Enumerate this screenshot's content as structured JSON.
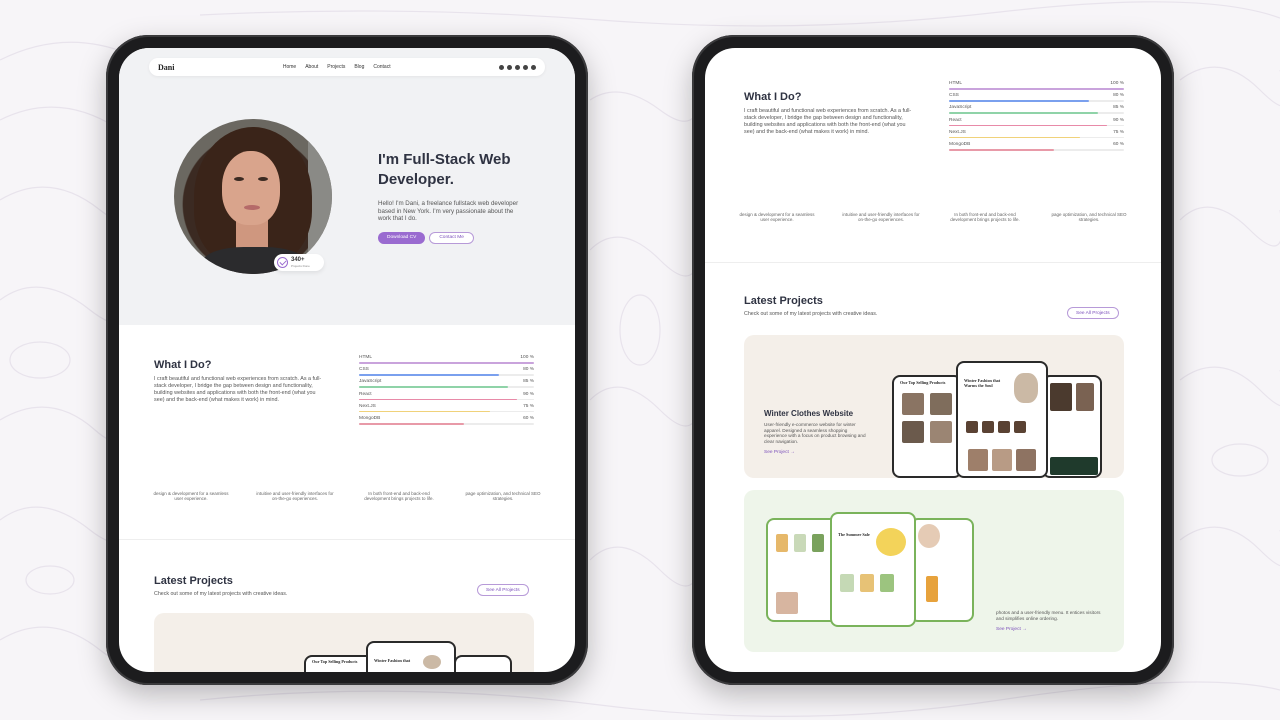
{
  "site": {
    "logo": "Dani",
    "nav": [
      "Home",
      "About",
      "Projects",
      "Blog",
      "Contact"
    ],
    "social_icons": [
      "facebook-icon",
      "instagram-icon",
      "twitter-icon",
      "youtube-icon",
      "dribbble-icon"
    ]
  },
  "hero": {
    "title": "I'm Full-Stack Web Developer.",
    "intro": "Hello! I'm Dani, a freelance fullstack web developer based in New York. I'm very passionate about the work that I do.",
    "download_cv": "Download CV",
    "contact_me": "Contact Me",
    "badge_count": "340+",
    "badge_label": "Projects Done"
  },
  "what_i_do": {
    "title": "What I Do?",
    "description": "I craft beautiful and functional web experiences from scratch. As a full-stack developer, I bridge the gap between design and functionality, building websites and applications with both the front-end (what you see) and the back-end (what makes it work) in mind.",
    "skills": [
      {
        "name": "HTML",
        "percent": "100 %",
        "value": 1.0,
        "color": "#c9a3dc"
      },
      {
        "name": "CSS",
        "percent": "80 %",
        "value": 0.8,
        "color": "#7aa0ee"
      },
      {
        "name": "JavaScript",
        "percent": "85 %",
        "value": 0.85,
        "color": "#8fd3a8"
      },
      {
        "name": "React",
        "percent": "90 %",
        "value": 0.9,
        "color": "#e88aa8"
      },
      {
        "name": "Next.JS",
        "percent": "75 %",
        "value": 0.75,
        "color": "#f0d27a"
      },
      {
        "name": "MongoDB",
        "percent": "60 %",
        "value": 0.6,
        "color": "#e89aa8"
      }
    ]
  },
  "services": [
    "design & development for a seamless user experience.",
    "intuitive and user-friendly interfaces for on-the-go experiences.",
    "In both front-end and back-end development brings projects to life.",
    "page optimization, and technical SEO strategies."
  ],
  "projects": {
    "title": "Latest Projects",
    "subtitle": "Check out some of my latest projects with creative ideas.",
    "see_all": "See All Projects",
    "winter": {
      "title": "Winter Clothes Website",
      "description": "User-friendly e-commerce website for winter apparel. Designed a seamless shopping experience with a focus on product browsing and clear navigation.",
      "link": "See Project →",
      "mockup_heading": "Winter Fashion that Warms the Soul",
      "mockup_top_selling": "Our Top Selling Products",
      "mockup_heading_short": "Winter Fashion that"
    },
    "skincare": {
      "description": "photos and a user-friendly menu. It entices visitors and simplifies online ordering.",
      "link": "See Project →",
      "mockup_title": "The Summer Sale"
    }
  }
}
